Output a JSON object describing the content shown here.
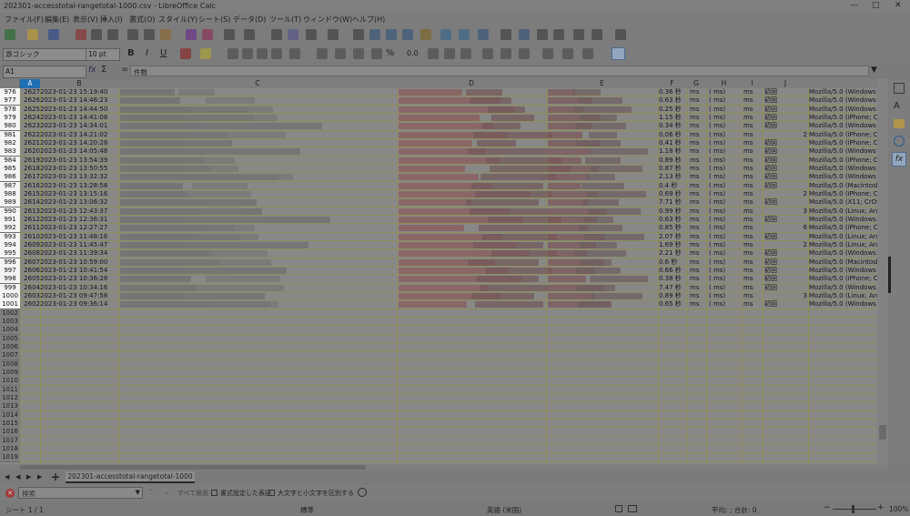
{
  "window": {
    "title": "202301-accesstotal-rangetotal-1000.csv - LibreOffice Calc"
  },
  "menu": [
    "ファイル(F)",
    "編集(E)",
    "表示(V)",
    "挿入(I)",
    "書式(O)",
    "スタイル(Y)",
    "シート(S)",
    "データ(D)",
    "ツール(T)",
    "ウィンドウ(W)",
    "ヘルプ(H)"
  ],
  "toolbar": {
    "font_name": "游ゴシック",
    "font_size": "10 pt"
  },
  "formula_bar": {
    "cell_ref": "A1",
    "content": "件数"
  },
  "columns": [
    "A",
    "B",
    "C",
    "D",
    "E",
    "F",
    "G",
    "H",
    "I",
    "J"
  ],
  "rows": [
    {
      "num": "976",
      "a": "2627",
      "b": "2023-01-23 15:19:40",
      "f": "0.36 秒",
      "g": "ms",
      "h": "( ms)",
      "i": "ms",
      "j": "初回",
      "k": "",
      "l": "Mozilla/5.0 (Windows N"
    },
    {
      "num": "977",
      "a": "2626",
      "b": "2023-01-23 14:46:23",
      "f": "0.63 秒",
      "g": "ms",
      "h": "( ms)",
      "i": "ms",
      "j": "初回",
      "k": "",
      "l": "Mozilla/5.0 (Windows N"
    },
    {
      "num": "978",
      "a": "2625",
      "b": "2023-01-23 14:44:50",
      "f": "0.25 秒",
      "g": "ms",
      "h": "( ms)",
      "i": "ms",
      "j": "初回",
      "k": "",
      "l": "Mozilla/5.0 (Windows N"
    },
    {
      "num": "979",
      "a": "2624",
      "b": "2023-01-23 14:41:08",
      "f": "1.15 秒",
      "g": "ms",
      "h": "( ms)",
      "i": "ms",
      "j": "初回",
      "k": "",
      "l": "Mozilla/5.0 (iPhone; CP"
    },
    {
      "num": "980",
      "a": "2623",
      "b": "2023-01-23 14:34:01",
      "f": "0.34 秒",
      "g": "ms",
      "h": "( ms)",
      "i": "ms",
      "j": "初回",
      "k": "",
      "l": "Mozilla/5.0 (Windows N"
    },
    {
      "num": "981",
      "a": "2622",
      "b": "2023-01-23 14:21:02",
      "f": "0.06 秒",
      "g": "ms",
      "h": "( ms)",
      "i": "ms",
      "j": "",
      "k": "2",
      "l": "Mozilla/5.0 (iPhone; CP"
    },
    {
      "num": "982",
      "a": "2621",
      "b": "2023-01-23 14:20:28",
      "f": "0.41 秒",
      "g": "ms",
      "h": "( ms)",
      "i": "ms",
      "j": "初回",
      "k": "",
      "l": "Mozilla/5.0 (iPhone; CP"
    },
    {
      "num": "983",
      "a": "2620",
      "b": "2023-01-23 14:05:48",
      "f": "1.18 秒",
      "g": "ms",
      "h": "( ms)",
      "i": "ms",
      "j": "初回",
      "k": "",
      "l": "Mozilla/5.0 (Windows N"
    },
    {
      "num": "984",
      "a": "2619",
      "b": "2023-01-23 13:54:39",
      "f": "0.89 秒",
      "g": "ms",
      "h": "( ms)",
      "i": "ms",
      "j": "初回",
      "k": "",
      "l": "Mozilla/5.0 (iPhone; CP"
    },
    {
      "num": "985",
      "a": "2618",
      "b": "2023-01-23 13:50:55",
      "f": "0.87 秒",
      "g": "ms",
      "h": "( ms)",
      "i": "ms",
      "j": "初回",
      "k": "",
      "l": "Mozilla/5.0 (Windows N"
    },
    {
      "num": "986",
      "a": "2617",
      "b": "2023-01-23 13:32:32",
      "f": "2.13 秒",
      "g": "ms",
      "h": "( ms)",
      "i": "ms",
      "j": "初回",
      "k": "",
      "l": "Mozilla/5.0 (Windows N"
    },
    {
      "num": "987",
      "a": "2616",
      "b": "2023-01-23 13:28:58",
      "f": "0.4 秒",
      "g": "ms",
      "h": "( ms)",
      "i": "ms",
      "j": "初回",
      "k": "",
      "l": "Mozilla/5.0 (Macintosh;"
    },
    {
      "num": "988",
      "a": "2615",
      "b": "2023-01-23 13:15:16",
      "f": "0.69 秒",
      "g": "ms",
      "h": "( ms)",
      "i": "ms",
      "j": "",
      "k": "2",
      "l": "Mozilla/5.0 (iPhone; CP"
    },
    {
      "num": "989",
      "a": "2614",
      "b": "2023-01-23 13:06:32",
      "f": "7.71 秒",
      "g": "ms",
      "h": "( ms)",
      "i": "ms",
      "j": "初回",
      "k": "",
      "l": "Mozilla/5.0 (X11; CrOS"
    },
    {
      "num": "990",
      "a": "2613",
      "b": "2023-01-23 12:43:37",
      "f": "0.99 秒",
      "g": "ms",
      "h": "( ms)",
      "i": "ms",
      "j": "",
      "k": "3",
      "l": "Mozilla/5.0 (Linux; Andr"
    },
    {
      "num": "991",
      "a": "2612",
      "b": "2023-01-23 12:36:31",
      "f": "0.63 秒",
      "g": "ms",
      "h": "( ms)",
      "i": "ms",
      "j": "初回",
      "k": "",
      "l": "Mozilla/5.0 (Windows N"
    },
    {
      "num": "992",
      "a": "2611",
      "b": "2023-01-23 12:27:27",
      "f": "0.85 秒",
      "g": "ms",
      "h": "( ms)",
      "i": "ms",
      "j": "",
      "k": "6",
      "l": "Mozilla/5.0 (iPhone; CP"
    },
    {
      "num": "993",
      "a": "2610",
      "b": "2023-01-23 11:48:16",
      "f": "2.07 秒",
      "g": "ms",
      "h": "( ms)",
      "i": "ms",
      "j": "初回",
      "k": "",
      "l": "Mozilla/5.0 (Linux; Andr"
    },
    {
      "num": "994",
      "a": "2609",
      "b": "2023-01-23 11:45:47",
      "f": "1.69 秒",
      "g": "ms",
      "h": "( ms)",
      "i": "ms",
      "j": "",
      "k": "2",
      "l": "Mozilla/5.0 (Linux; Andr"
    },
    {
      "num": "995",
      "a": "2608",
      "b": "2023-01-23 11:39:34",
      "f": "2.21 秒",
      "g": "ms",
      "h": "( ms)",
      "i": "ms",
      "j": "初回",
      "k": "",
      "l": "Mozilla/5.0 (Windows N"
    },
    {
      "num": "996",
      "a": "2607",
      "b": "2023-01-23 10:59:00",
      "f": "0.6 秒",
      "g": "ms",
      "h": "( ms)",
      "i": "ms",
      "j": "初回",
      "k": "",
      "l": "Mozilla/5.0 (Macintosh;"
    },
    {
      "num": "997",
      "a": "2606",
      "b": "2023-01-23 10:41:54",
      "f": "0.66 秒",
      "g": "ms",
      "h": "( ms)",
      "i": "ms",
      "j": "初回",
      "k": "",
      "l": "Mozilla/5.0 (Windows N"
    },
    {
      "num": "998",
      "a": "2605",
      "b": "2023-01-23 10:36:28",
      "f": "0.38 秒",
      "g": "ms",
      "h": "( ms)",
      "i": "ms",
      "j": "初回",
      "k": "",
      "l": "Mozilla/5.0 (iPhone; CP"
    },
    {
      "num": "999",
      "a": "2604",
      "b": "2023-01-23 10:34:16",
      "f": "7.47 秒",
      "g": "ms",
      "h": "( ms)",
      "i": "ms",
      "j": "初回",
      "k": "",
      "l": "Mozilla/5.0 (Windows N"
    },
    {
      "num": "1000",
      "a": "2603",
      "b": "2023-01-23 09:47:58",
      "f": "0.89 秒",
      "g": "ms",
      "h": "( ms)",
      "i": "ms",
      "j": "",
      "k": "3",
      "l": "Mozilla/5.0 (Linux; Andr"
    },
    {
      "num": "1001",
      "a": "2602",
      "b": "2023-01-23 09:36:14",
      "f": "0.65 秒",
      "g": "ms",
      "h": "( ms)",
      "i": "ms",
      "j": "初回",
      "k": "",
      "l": "Mozilla/5.0 (Windows N"
    }
  ],
  "empty_rows": [
    "1002",
    "1003",
    "1004",
    "1005",
    "1006",
    "1007",
    "1008",
    "1009",
    "1010",
    "1011",
    "1012",
    "1013",
    "1014",
    "1015",
    "1016",
    "1017",
    "1018",
    "1019"
  ],
  "sheet_tab": "202301-accesstotal-rangetotal-1000",
  "find": {
    "placeholder": "検索",
    "search_all": "すべて検索",
    "formatted_display": "書式設定した表記",
    "match_case": "大文字と小文字を区別する"
  },
  "status": {
    "sheet": "シート 1 / 1",
    "style": "標準",
    "language": "英語 (米国)",
    "sum": "平均: ; 合計: 0",
    "zoom": "100%"
  },
  "colors": {
    "accent": "#1f6fb5",
    "selected_header": "#f4f4f4",
    "grid_line": "#8e8d5a",
    "chrome": "#7c7c7c"
  }
}
